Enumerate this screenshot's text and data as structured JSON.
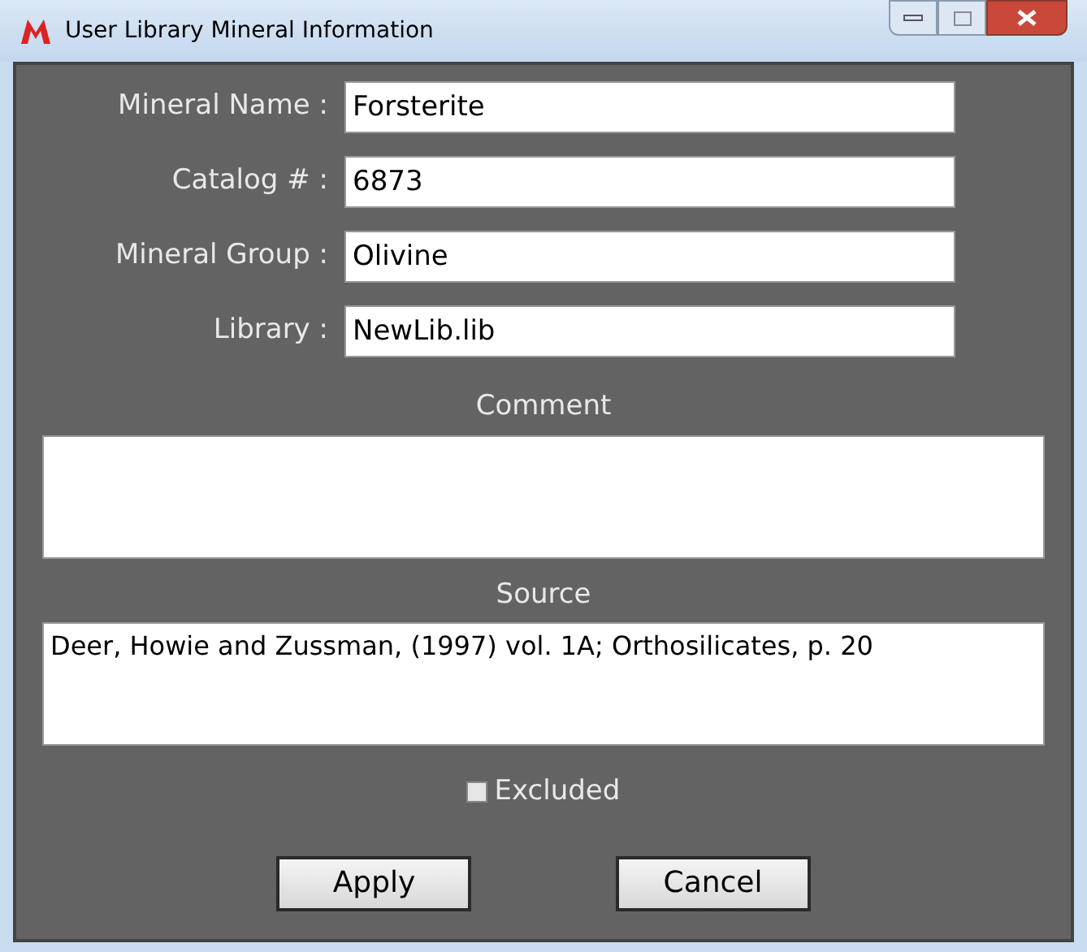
{
  "window": {
    "title": "User Library Mineral Information"
  },
  "fields": [
    {
      "label": "Mineral Name :",
      "value": "Forsterite"
    },
    {
      "label": "Catalog # :",
      "value": "6873"
    },
    {
      "label": "Mineral Group :",
      "value": "Olivine"
    },
    {
      "label": "Library :",
      "value": "NewLib.lib"
    }
  ],
  "comment": {
    "label": "Comment"
  },
  "source": {
    "label": "Source",
    "value": "Deer, Howie and Zussman, (1997) vol. 1A; Orthosilicates, p. 20"
  },
  "excluded": {
    "label": "Excluded",
    "checked": false
  },
  "buttons": [
    "Apply",
    "Cancel"
  ]
}
